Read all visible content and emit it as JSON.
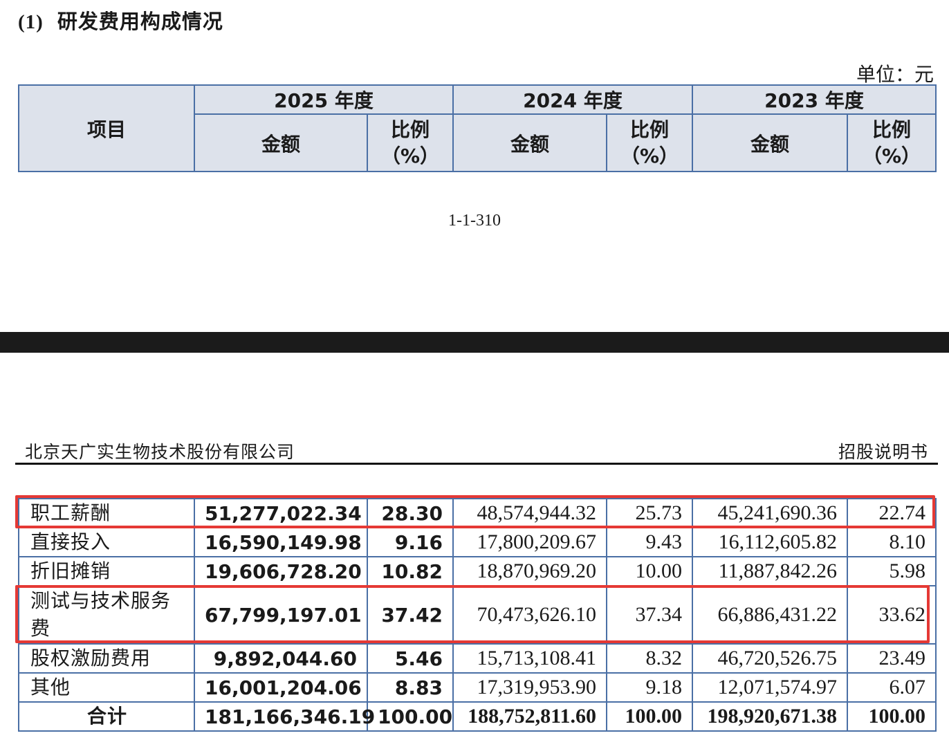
{
  "section": {
    "number": "(1)",
    "title": "研发费用构成情况"
  },
  "unit": "单位：元",
  "table_header": {
    "item": "项目",
    "years": [
      "2025 年度",
      "2024 年度",
      "2023 年度"
    ],
    "amount": "金额",
    "ratio_line1": "比例",
    "ratio_line2": "（%）"
  },
  "page_number": "1-1-310",
  "running_header": {
    "company": "北京天广实生物技术股份有限公司",
    "doc_type": "招股说明书"
  },
  "rows": [
    {
      "name": "职工薪酬",
      "y2025": "51,277,022.34",
      "r2025": "28.30",
      "y2024": "48,574,944.32",
      "r2024": "25.73",
      "y2023": "45,241,690.36",
      "r2023": "22.74",
      "highlighted": true
    },
    {
      "name": "直接投入",
      "y2025": "16,590,149.98",
      "r2025": "9.16",
      "y2024": "17,800,209.67",
      "r2024": "9.43",
      "y2023": "16,112,605.82",
      "r2023": "8.10",
      "highlighted": false
    },
    {
      "name": "折旧摊销",
      "y2025": "19,606,728.20",
      "r2025": "10.82",
      "y2024": "18,870,969.20",
      "r2024": "10.00",
      "y2023": "11,887,842.26",
      "r2023": "5.98",
      "highlighted": false
    },
    {
      "name": "测试与技术服务费",
      "y2025": "67,799,197.01",
      "r2025": "37.42",
      "y2024": "70,473,626.10",
      "r2024": "37.34",
      "y2023": "66,886,431.22",
      "r2023": "33.62",
      "highlighted": true
    },
    {
      "name": "股权激励费用",
      "y2025": "9,892,044.60",
      "r2025": "5.46",
      "y2024": "15,713,108.41",
      "r2024": "8.32",
      "y2023": "46,720,526.75",
      "r2023": "23.49",
      "highlighted": false
    },
    {
      "name": "其他",
      "y2025": "16,001,204.06",
      "r2025": "8.83",
      "y2024": "17,319,953.90",
      "r2024": "9.18",
      "y2023": "12,071,574.97",
      "r2023": "6.07",
      "highlighted": false
    }
  ],
  "total": {
    "name": "合计",
    "y2025": "181,166,346.19",
    "r2025": "100.00",
    "y2024": "188,752,811.60",
    "r2024": "100.00",
    "y2023": "198,920,671.38",
    "r2023": "100.00"
  },
  "colors": {
    "border": "#4a6fa5",
    "header_bg": "#dde2eb",
    "highlight": "#e53935",
    "band": "#1b1b1b"
  }
}
